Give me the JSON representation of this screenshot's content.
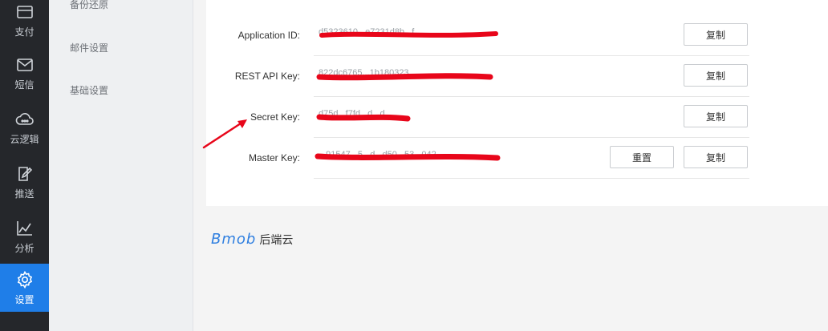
{
  "sidebar": {
    "items": [
      {
        "label": "支付",
        "icon": "card-icon"
      },
      {
        "label": "短信",
        "icon": "mail-icon"
      },
      {
        "label": "云逻辑",
        "icon": "cloud-icon"
      },
      {
        "label": "推送",
        "icon": "push-icon"
      },
      {
        "label": "分析",
        "icon": "chart-icon"
      },
      {
        "label": "设置",
        "icon": "gear-icon",
        "active": true
      }
    ]
  },
  "submenu": {
    "items": [
      {
        "label": "备份还原"
      },
      {
        "label": "邮件设置"
      },
      {
        "label": "基础设置"
      }
    ]
  },
  "keys": {
    "rows": [
      {
        "label": "Application ID:",
        "value": "d5323610...e7231d8b...f",
        "copy": "复制"
      },
      {
        "label": "REST API Key:",
        "value": "822dc6765...1b180323",
        "copy": "复制"
      },
      {
        "label": "Secret Key:",
        "value": "d75d...f7fd...d...d",
        "copy": "复制"
      },
      {
        "label": "Master Key:",
        "value": "...91547...5...d...d50...53...042",
        "copy": "复制",
        "reset": "重置"
      }
    ]
  },
  "footer": {
    "logo": "Bmob",
    "suffix": "后端云"
  },
  "colors": {
    "accent": "#1f7ee8",
    "sidebar": "#25272b",
    "redaction": "#e8061a"
  }
}
